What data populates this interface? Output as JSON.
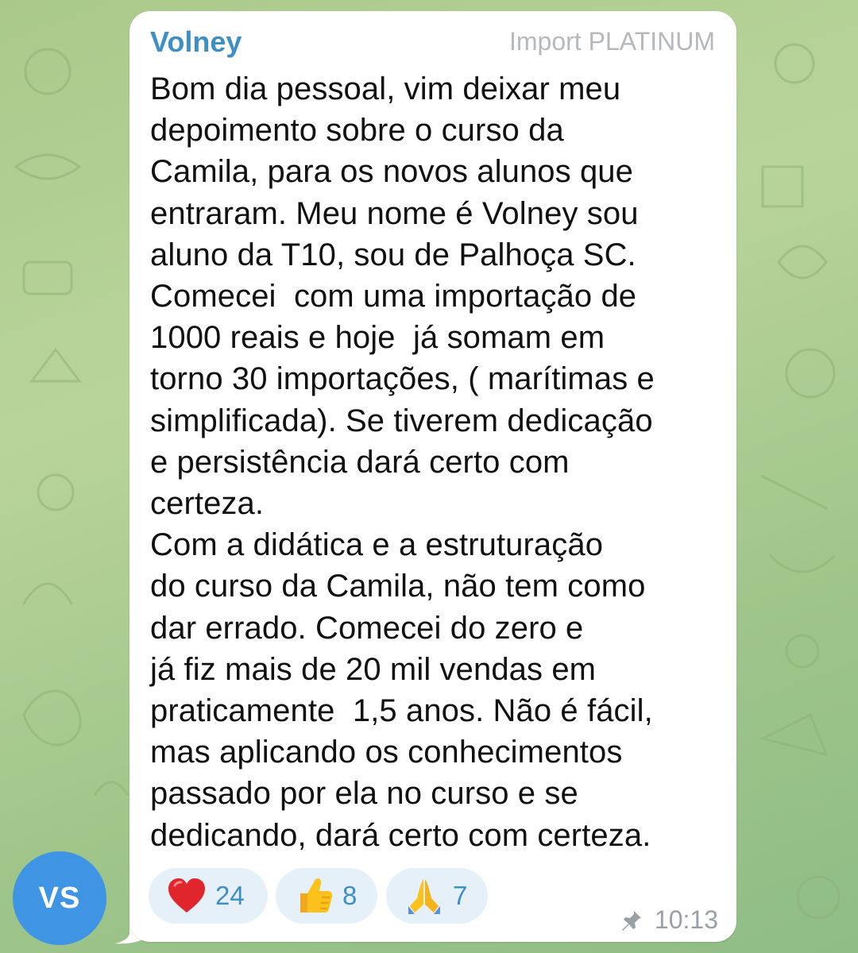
{
  "chat": {
    "message": {
      "sender": "Volney",
      "rank": "Import PLATINUM",
      "text": "Bom dia pessoal, vim deixar meu\ndepoimento sobre o curso da\nCamila, para os novos alunos que\nentraram. Meu nome é Volney sou\naluno da T10, sou de Palhoça SC.\nComecei  com uma importação de\n1000 reais e hoje  já somam em\ntorno 30 importações, ( marítimas e\nsimplificada). Se tiverem dedicação\ne persistência dará certo com\ncerteza.\nCom a didática e a estruturação\ndo curso da Camila, não tem como\ndar errado. Comecei do zero e\njá fiz mais de 20 mil vendas em\npraticamente  1,5 anos. Não é fácil,\nmas aplicando os conhecimentos\npassado por ela no curso e se\ndedicando, dará certo com certeza.",
      "time": "10:13",
      "pinned_icon": "pin-icon",
      "reactions": [
        {
          "emoji": "red-heart",
          "count": "24"
        },
        {
          "emoji": "thumbs-up",
          "count": "8"
        },
        {
          "emoji": "folded-hands",
          "count": "7"
        }
      ]
    },
    "avatar": {
      "initials": "VS",
      "color": "#3f95e3"
    },
    "colors": {
      "sender_name": "#3d8fc6",
      "reaction_bg": "#e6f0f8",
      "bubble": "#ffffff"
    }
  }
}
